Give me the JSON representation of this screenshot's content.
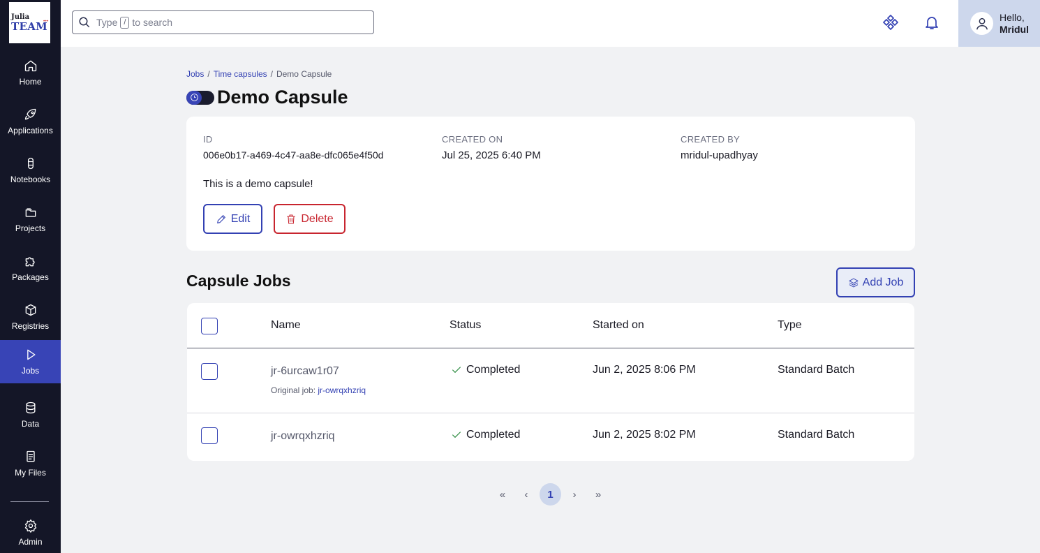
{
  "logo": {
    "line1": "Julia",
    "line2": "TEAM"
  },
  "sidebar": {
    "items": [
      {
        "label": "Home",
        "icon": "home-icon"
      },
      {
        "label": "Applications",
        "icon": "rocket-icon"
      },
      {
        "label": "Notebooks",
        "icon": "notebook-icon"
      },
      {
        "label": "Projects",
        "icon": "folders-icon"
      },
      {
        "label": "Packages",
        "icon": "puzzle-icon"
      },
      {
        "label": "Registries",
        "icon": "box-icon"
      },
      {
        "label": "Jobs",
        "icon": "play-icon",
        "active": true
      },
      {
        "label": "Data",
        "icon": "database-icon"
      },
      {
        "label": "My Files",
        "icon": "files-icon"
      },
      {
        "label": "Admin",
        "icon": "gear-icon"
      }
    ]
  },
  "header": {
    "search_prefix": "Type",
    "search_key": "/",
    "search_suffix": "to search",
    "user_greeting": "Hello,",
    "user_name": "Mridul"
  },
  "breadcrumb": {
    "jobs": "Jobs",
    "time_capsules": "Time capsules",
    "current": "Demo Capsule",
    "separator": "/"
  },
  "page": {
    "title": "Demo Capsule"
  },
  "capsule": {
    "id_label": "ID",
    "id_value": "006e0b17-a469-4c47-aa8e-dfc065e4f50d",
    "created_on_label": "CREATED ON",
    "created_on_value": "Jul 25, 2025 6:40 PM",
    "created_by_label": "CREATED BY",
    "created_by_value": "mridul-upadhyay",
    "description": "This is a demo capsule!",
    "edit_label": "Edit",
    "delete_label": "Delete"
  },
  "jobs_section": {
    "title": "Capsule Jobs",
    "add_label": "Add Job",
    "columns": {
      "name": "Name",
      "status": "Status",
      "started": "Started on",
      "type": "Type"
    },
    "rows": [
      {
        "name": "jr-6urcaw1r07",
        "original_prefix": "Original job:",
        "original_link": "jr-owrqxhzriq",
        "status": "Completed",
        "started": "Jun 2, 2025 8:06 PM",
        "type": "Standard Batch"
      },
      {
        "name": "jr-owrqxhzriq",
        "status": "Completed",
        "started": "Jun 2, 2025 8:02 PM",
        "type": "Standard Batch"
      }
    ]
  },
  "pagination": {
    "first": "«",
    "prev": "‹",
    "current": "1",
    "next": "›",
    "last": "»"
  },
  "colors": {
    "accent": "#3341b3",
    "sidebar_bg": "#141627",
    "danger": "#c8252f",
    "success": "#2a8a3e"
  }
}
